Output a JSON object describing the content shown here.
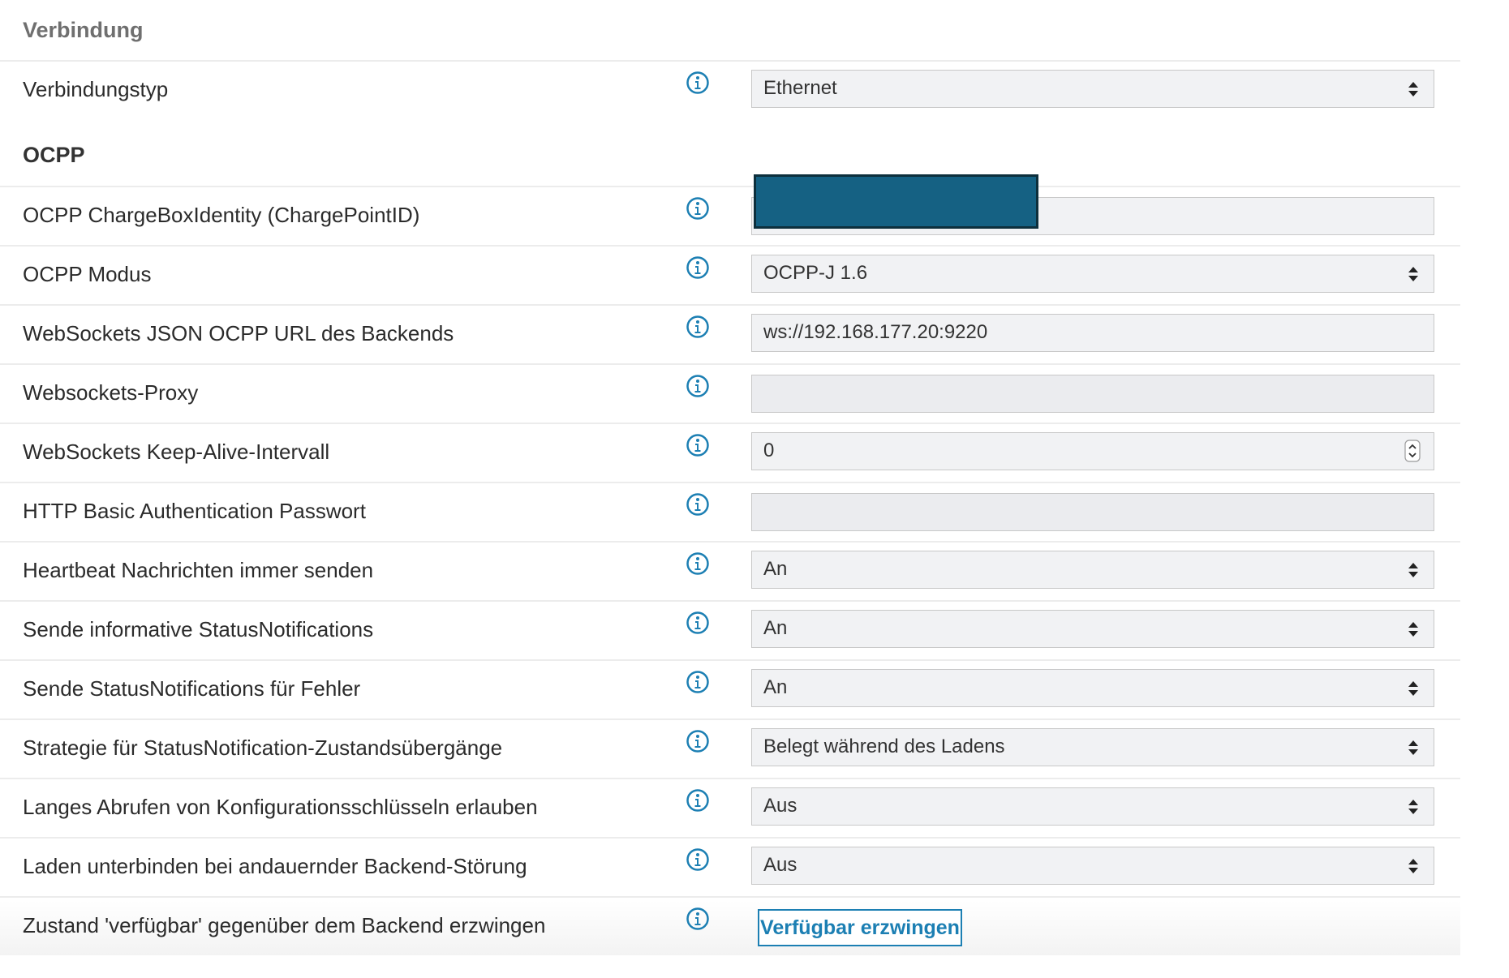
{
  "sections": {
    "connection_title": "Verbindung",
    "ocpp_title": "OCPP"
  },
  "connection": {
    "type_label": "Verbindungstyp",
    "type_value": "Ethernet"
  },
  "ocpp": {
    "chargebox_label": "OCPP ChargeBoxIdentity (ChargePointID)",
    "chargebox_value": "",
    "mode_label": "OCPP Modus",
    "mode_value": "OCPP-J 1.6",
    "url_label": "WebSockets JSON OCPP URL des Backends",
    "url_value": "ws://192.168.177.20:9220",
    "proxy_label": "Websockets-Proxy",
    "proxy_value": "",
    "keepalive_label": "WebSockets Keep-Alive-Intervall",
    "keepalive_value": "0",
    "password_label": "HTTP Basic Authentication Passwort",
    "password_value": "",
    "heartbeat_label": "Heartbeat Nachrichten immer senden",
    "heartbeat_value": "An",
    "informative_label": "Sende informative StatusNotifications",
    "informative_value": "An",
    "errors_label": "Sende StatusNotifications für Fehler",
    "errors_value": "An",
    "strategy_label": "Strategie für StatusNotification-Zustandsübergänge",
    "strategy_value": "Belegt während des Ladens",
    "longpoll_label": "Langes Abrufen von Konfigurationsschlüsseln erlauben",
    "longpoll_value": "Aus",
    "backend_failure_label": "Laden unterbinden bei andauernder Backend-Störung",
    "backend_failure_value": "Aus",
    "force_available_label": "Zustand 'verfügbar' gegenüber dem Backend erzwingen",
    "force_available_button": "Verfügbar erzwingen"
  },
  "colors": {
    "accent": "#1c7fb3",
    "redaction": "#156183",
    "info_icon": "#1c7fb3"
  },
  "icons": {
    "info": "info-circle-icon",
    "select": "select-arrows-icon",
    "spinner": "spinner-icon"
  }
}
